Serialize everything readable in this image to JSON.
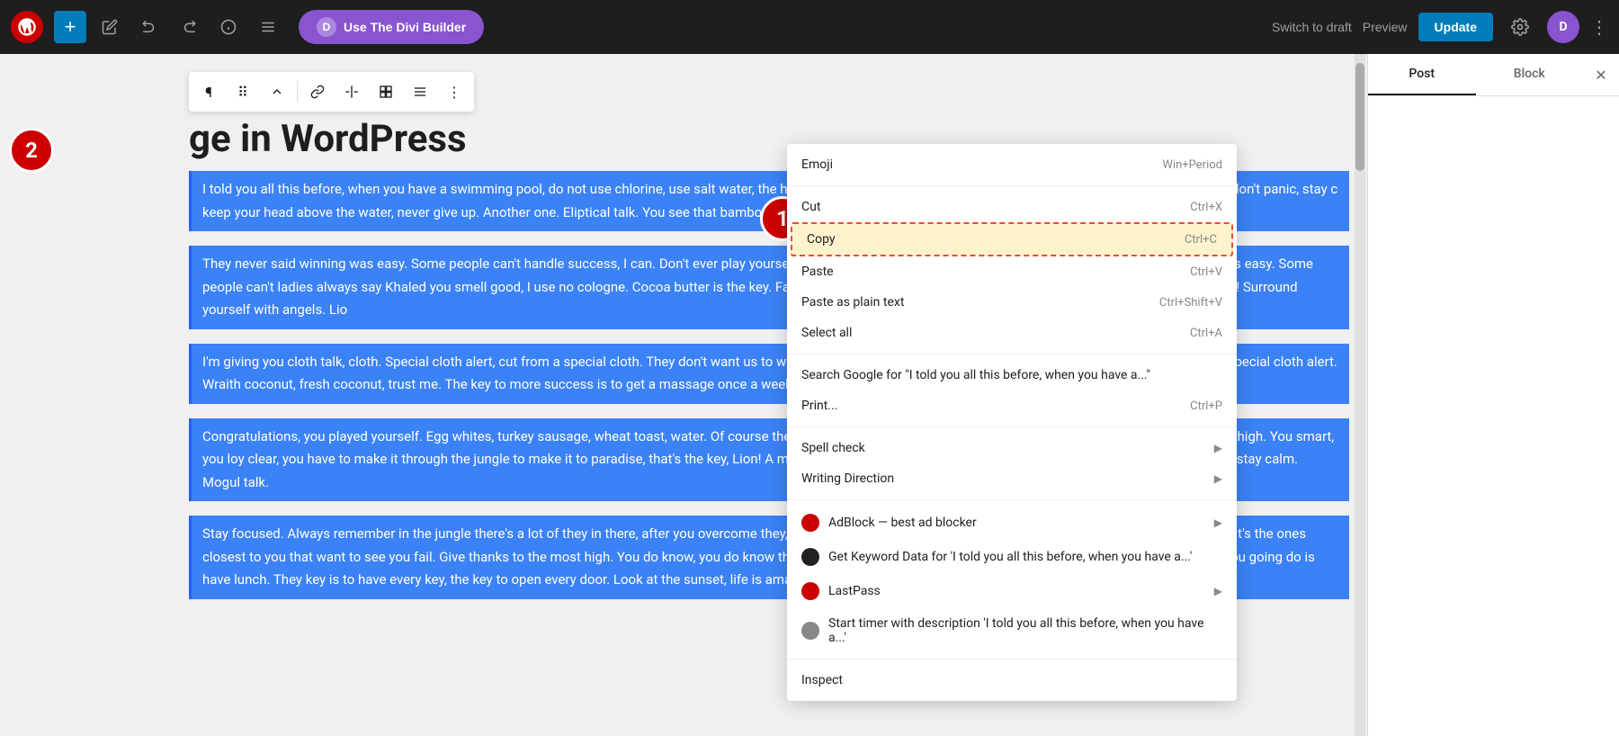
{
  "topbar": {
    "add_label": "+",
    "undo_label": "↩",
    "redo_label": "↪",
    "info_label": "ⓘ",
    "list_label": "≡",
    "divi_label": "Use The Divi Builder",
    "divi_icon": "D",
    "switch_draft": "Switch to draft",
    "preview": "Preview",
    "update": "Update",
    "gear": "⚙",
    "divi_circle": "D",
    "more": "⋮"
  },
  "block_toolbar": {
    "paragraph": "¶",
    "drag": "⠿",
    "arrow": "⌃",
    "link": "🔗",
    "split": "⊢",
    "align": "⊞",
    "justify": "≡",
    "more": "⋮"
  },
  "page": {
    "title": "ge in WordPress"
  },
  "content": {
    "blocks": [
      "I told you all this before, when you have a swimming pool, do not use chlorine, use salt water, the healing. A major key, never panic. Don't panic, when it gets crazy and rough, don't panic, stay c keep your head above the water, never give up. Another one. Eliptical talk. You see that bamboo that bamboo? Ain't nothin' like bamboo. Bless up.",
      "They never said winning was easy. Some people can't handle success, I can. Don't ever play yourself. Celebrate success right, the only way, apple. They never said winning was easy. Some people can't ladies always say Khaled you smell good, I use no cologne. Cocoa butter is the key. Fan luv. Let me it through the jungle to make it to paradise, that's the key, Lion! Surround yourself with angels. Lio",
      "I'm giving you cloth talk, cloth. Special cloth alert, cut from a special cloth. They don't want us to win to make it through the jungle to make it to paradise, that's the key, Lion! Special cloth alert. Wraith coconut, fresh coconut, trust me. The key to more success is to get a massage once a week, very im talk. Congratulations, you played yourself.",
      "Congratulations, you played yourself. Egg whites, turkey sausage, wheat toast, water. Of course the breakfast, so we are going to enjoy our breakfast. Give thanks to the most high. You smart, you loy clear, you have to make it through the jungle to make it to paradise, that's the key, Lion! A major key, never panic. Don't panic, when it gets crazy and rough, don't panic, stay calm. Mogul talk.",
      "Stay focused. Always remember in the jungle there's a lot of they in there, after you overcome they, you will make it to paradise. Major key, don't fall for the trap, stay focused. It's the ones closest to you that want to see you fail. Give thanks to the most high. You do know, you do know that they don't want you to have lunch. I'm keeping it real with you, so what you going do is have lunch. They key is to have every key, the key to open every door. Look at the sunset, life is amazing, life is beautiful, life is what you make it."
    ]
  },
  "badges": {
    "badge1": "1",
    "badge2": "2"
  },
  "sidebar": {
    "tab_post": "Post",
    "tab_block": "Block"
  },
  "context_menu": {
    "items": [
      {
        "label": "Emoji",
        "shortcut": "Win+Period",
        "has_arrow": false,
        "icon": null,
        "highlighted": false
      },
      {
        "label": "Cut",
        "shortcut": "Ctrl+X",
        "has_arrow": false,
        "icon": null,
        "highlighted": false
      },
      {
        "label": "Copy",
        "shortcut": "Ctrl+C",
        "has_arrow": false,
        "icon": null,
        "highlighted": true
      },
      {
        "label": "Paste",
        "shortcut": "Ctrl+V",
        "has_arrow": false,
        "icon": null,
        "highlighted": false
      },
      {
        "label": "Paste as plain text",
        "shortcut": "Ctrl+Shift+V",
        "has_arrow": false,
        "icon": null,
        "highlighted": false
      },
      {
        "label": "Select all",
        "shortcut": "Ctrl+A",
        "has_arrow": false,
        "icon": null,
        "highlighted": false
      },
      {
        "label": "Search Google for “I told you all this before, when you have a...”",
        "shortcut": "",
        "has_arrow": false,
        "icon": null,
        "highlighted": false
      },
      {
        "label": "Print...",
        "shortcut": "Ctrl+P",
        "has_arrow": false,
        "icon": null,
        "highlighted": false
      },
      {
        "label": "Spell check",
        "shortcut": "",
        "has_arrow": true,
        "icon": null,
        "highlighted": false
      },
      {
        "label": "Writing Direction",
        "shortcut": "",
        "has_arrow": true,
        "icon": null,
        "highlighted": false
      },
      {
        "label": "AdBlock — best ad blocker",
        "shortcut": "",
        "has_arrow": true,
        "icon": "red",
        "highlighted": false
      },
      {
        "label": "Get Keyword Data for 'I told you all this before, when you have a...'",
        "shortcut": "",
        "has_arrow": false,
        "icon": "dark",
        "highlighted": false
      },
      {
        "label": "LastPass",
        "shortcut": "",
        "has_arrow": true,
        "icon": "red2",
        "highlighted": false
      },
      {
        "label": "Start timer with description 'I told you all this before, when you have a...'",
        "shortcut": "",
        "has_arrow": false,
        "icon": "gray",
        "highlighted": false
      },
      {
        "label": "Inspect",
        "shortcut": "",
        "has_arrow": false,
        "icon": null,
        "highlighted": false
      }
    ]
  }
}
